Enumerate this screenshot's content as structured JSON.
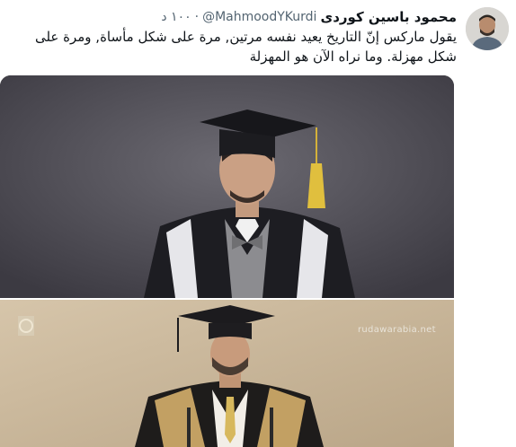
{
  "tweet": {
    "display_name": "محمود باسين كوردى",
    "handle": "@MahmoodYKurdi",
    "separator": "·",
    "time": "١٠٠ د",
    "text": "يقول ماركس إنّ التاريخ يعيد نفسه مرتين, مرة على شكل مأساة, ومرة على شكل مهزلة. وما نراه الآن هو المهزلة"
  },
  "media": {
    "watermark": "rudawarabia.net"
  },
  "colors": {
    "name": "#0f1419",
    "secondary": "#536471",
    "background": "#ffffff"
  }
}
